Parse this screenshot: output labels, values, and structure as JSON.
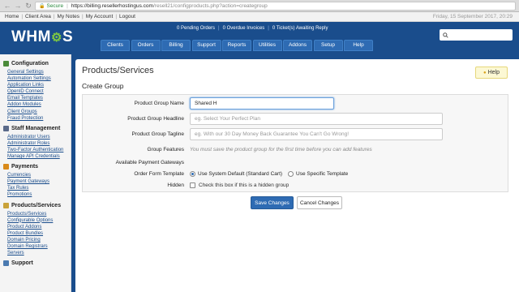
{
  "browser": {
    "back_icon": "back-arrow",
    "forward_icon": "forward-arrow",
    "reload_icon": "reload",
    "secure_label": "Secure",
    "url_host": "https://billing.resellerhostingus.com",
    "url_path": "/resell21/configproducts.php?action=creategroup"
  },
  "topbar": {
    "links": [
      "Home",
      "Client Area",
      "My Notes",
      "My Account",
      "Logout"
    ],
    "date": "Friday, 15 September 2017, 20:29"
  },
  "header": {
    "logo_text_left": "WHM",
    "logo_text_right": "S",
    "notifications": [
      "0 Pending Orders",
      "0 Overdue Invoices",
      "0 Ticket(s) Awaiting Reply"
    ],
    "nav": [
      "Clients",
      "Orders",
      "Billing",
      "Support",
      "Reports",
      "Utilities",
      "Addons",
      "Setup",
      "Help"
    ],
    "search_icon": "search"
  },
  "sidebar": {
    "sections": [
      {
        "title": "Configuration",
        "icon_color": "#4a8a3a",
        "items": [
          "General Settings",
          "Automation Settings",
          "Application Links",
          "OpenID Connect",
          "Email Templates",
          "Addon Modules",
          "Client Groups",
          "Fraud Protection"
        ]
      },
      {
        "title": "Staff Management",
        "icon_color": "#5a6a8a",
        "items": [
          "Administrator Users",
          "Administrator Roles",
          "Two-Factor Authentication",
          "Manage API Credentials"
        ]
      },
      {
        "title": "Payments",
        "icon_color": "#d98a1a",
        "items": [
          "Currencies",
          "Payment Gateways",
          "Tax Rules",
          "Promotions"
        ]
      },
      {
        "title": "Products/Services",
        "icon_color": "#c9a23a",
        "items": [
          "Products/Services",
          "Configurable Options",
          "Product Addons",
          "Product Bundles",
          "Domain Pricing",
          "Domain Registrars",
          "Servers"
        ]
      },
      {
        "title": "Support",
        "icon_color": "#4a7ab0",
        "items": []
      }
    ]
  },
  "main": {
    "page_title": "Products/Services",
    "help_label": "Help",
    "section_title": "Create Group",
    "form": {
      "group_name_label": "Product Group Name",
      "group_name_value": "Shared H",
      "headline_label": "Product Group Headline",
      "headline_placeholder": "eg. Select Your Perfect Plan",
      "tagline_label": "Product Group Tagline",
      "tagline_placeholder": "eg. With our 30 Day Money Back Guarantee You Can't Go Wrong!",
      "features_label": "Group Features",
      "features_note": "You must save the product group for the first time before you can add features",
      "gateways_label": "Available Payment Gateways",
      "template_label": "Order Form Template",
      "template_option_default": "Use System Default (Standard Cart)",
      "template_option_specific": "Use Specific Template",
      "hidden_label": "Hidden",
      "hidden_checkbox_label": "Check this box if this is a hidden group"
    },
    "save_label": "Save Changes",
    "cancel_label": "Cancel Changes"
  }
}
